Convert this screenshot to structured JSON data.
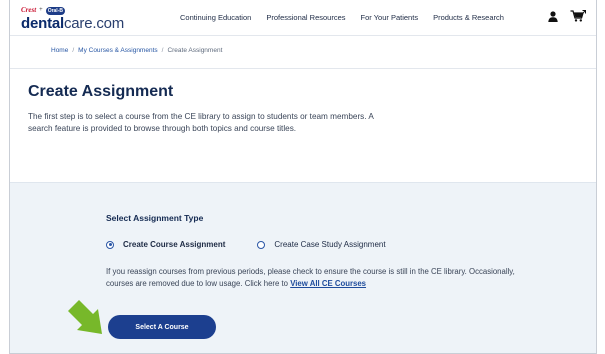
{
  "header": {
    "brand_crest": "Crest",
    "brand_plus": "+",
    "brand_oralb": "Oral-B",
    "logo_bold": "dental",
    "logo_light": "care.com",
    "nav": [
      "Continuing Education",
      "Professional Resources",
      "For Your Patients",
      "Products & Research"
    ],
    "icons": [
      "user-icon",
      "cart-icon"
    ]
  },
  "breadcrumb": {
    "home": "Home",
    "separator": "/",
    "courses": "My Courses & Assignments",
    "current": "Create Assignment"
  },
  "page": {
    "title": "Create Assignment",
    "intro": "The first step is to select a course from the CE library to assign to students or team members. A search feature is provided to browse through both topics and course titles."
  },
  "panel": {
    "title": "Select Assignment Type",
    "options": [
      {
        "label": "Create Course Assignment",
        "checked": true
      },
      {
        "label": "Create Case Study Assignment",
        "checked": false
      }
    ],
    "note_text": "If you reassign courses from previous periods, please check to ensure the course is still in the CE library. Occasionally, courses are removed due to low usage. Click here to ",
    "note_link": "View All CE Courses",
    "button_label": "Select A Course"
  },
  "colors": {
    "primary": "#1c3f8f",
    "panel_bg": "#eef3f8",
    "arrow": "#77b82a",
    "link": "#1f4c9c"
  }
}
